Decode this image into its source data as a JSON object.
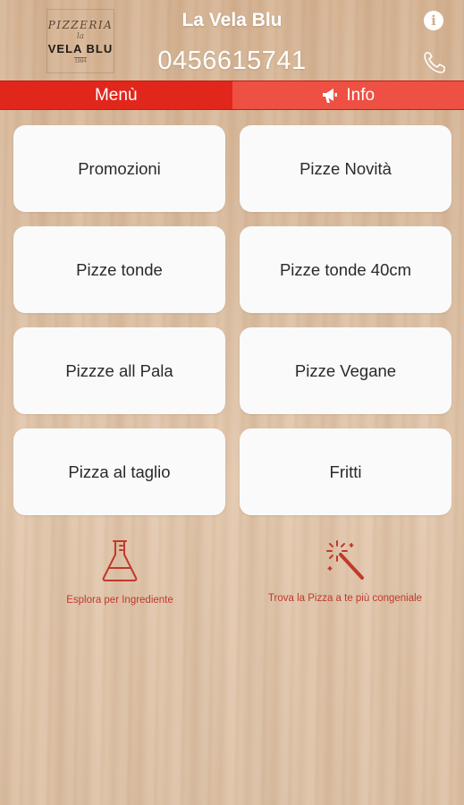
{
  "header": {
    "logo": {
      "line1": "PIZZERIA",
      "line2": "la",
      "line3": "VELA BLU",
      "line4": "1984"
    },
    "title": "La Vela Blu",
    "phone": "0456615741",
    "info_icon": "info-icon",
    "call_icon": "phone-icon"
  },
  "tabs": [
    {
      "label": "Menù",
      "active": true
    },
    {
      "label": "Info",
      "icon": "megaphone-icon",
      "active": false
    }
  ],
  "categories": [
    "Promozioni",
    "Pizze Novità",
    "Pizze tonde",
    "Pizze tonde 40cm",
    "Pizzze all Pala",
    "Pizze Vegane",
    "Pizza al taglio",
    "Fritti"
  ],
  "tools": [
    {
      "label": "Esplora per Ingrediente",
      "icon": "flask-icon"
    },
    {
      "label": "Trova la Pizza a te più congeniale",
      "icon": "magic-wand-icon"
    }
  ],
  "colors": {
    "accent": "#e1261c",
    "tab_inactive": "#ee5044",
    "tool_red": "#c0392b",
    "button_bg": "#fafafa"
  }
}
